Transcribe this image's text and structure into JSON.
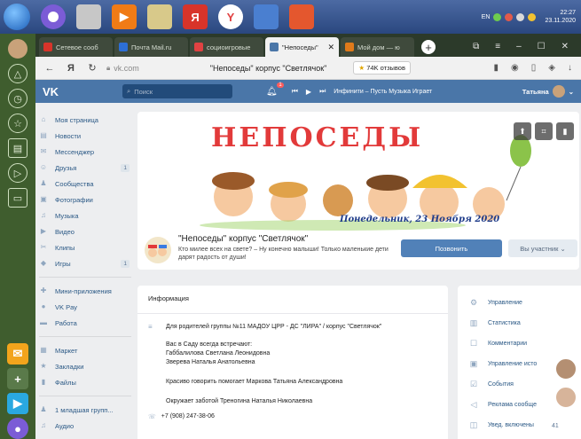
{
  "taskbar": {
    "apps": [
      {
        "icon": "start-orb"
      },
      {
        "icon": "app-circle-icon",
        "color": "#7b5cd6"
      },
      {
        "icon": "blank-window-icon",
        "color": "#c7c7c7"
      },
      {
        "icon": "media-player-icon",
        "color": "#f07b16"
      },
      {
        "icon": "notepad-icon",
        "color": "#d8c98a"
      },
      {
        "icon": "yandex-icon",
        "color": "#d8342a",
        "label": "Я"
      },
      {
        "icon": "yandex-browser-icon",
        "color": "#e14242",
        "label": "Y"
      },
      {
        "icon": "photo-viewer-icon",
        "color": "#4a7fd0"
      },
      {
        "icon": "presentation-icon",
        "color": "#e4572e"
      }
    ],
    "lang": "EN",
    "time": "22:27",
    "date": "23.11.2020"
  },
  "browser": {
    "tabs": [
      {
        "label": "Сетевое сооб",
        "fav_color": "#d8342a",
        "active": false
      },
      {
        "label": "Почта Mail.ru",
        "fav_color": "#2d6fd6",
        "active": false
      },
      {
        "label": "социоигровые",
        "fav_color": "#e14242",
        "active": false
      },
      {
        "label": "\"Непоседы\"",
        "fav_color": "#4a76a8",
        "active": true
      },
      {
        "label": "Мой дом — ю",
        "fav_color": "#e07a1a",
        "active": false
      }
    ],
    "url": "vk.com",
    "page_title": "\"Непоседы\" корпус \"Светлячок\"",
    "reviews": "74K отзывов"
  },
  "vk": {
    "logo": "VK",
    "search_placeholder": "Поиск",
    "player_text": "Инфинити – Пусть Музыка Играет",
    "user_name": "Татьяна",
    "menu": [
      {
        "icon": "home-icon",
        "glyph": "⌂",
        "label": "Моя страница",
        "count": ""
      },
      {
        "icon": "news-icon",
        "glyph": "▤",
        "label": "Новости",
        "count": ""
      },
      {
        "icon": "messenger-icon",
        "glyph": "✉",
        "label": "Мессенджер",
        "count": ""
      },
      {
        "icon": "friends-icon",
        "glyph": "☺",
        "label": "Друзья",
        "count": "1"
      },
      {
        "icon": "communities-icon",
        "glyph": "♟",
        "label": "Сообщества",
        "count": ""
      },
      {
        "icon": "photos-icon",
        "glyph": "▣",
        "label": "Фотографии",
        "count": ""
      },
      {
        "icon": "music-icon",
        "glyph": "♫",
        "label": "Музыка",
        "count": ""
      },
      {
        "icon": "video-icon",
        "glyph": "▶",
        "label": "Видео",
        "count": ""
      },
      {
        "icon": "clips-icon",
        "glyph": "✂",
        "label": "Клипы",
        "count": ""
      },
      {
        "icon": "games-icon",
        "glyph": "◆",
        "label": "Игры",
        "count": "1"
      }
    ],
    "menu2": [
      {
        "icon": "mini-apps-icon",
        "glyph": "✚",
        "label": "Мини-приложения"
      },
      {
        "icon": "vkpay-icon",
        "glyph": "●",
        "label": "VK Pay"
      },
      {
        "icon": "work-icon",
        "glyph": "▬",
        "label": "Работа"
      }
    ],
    "menu3": [
      {
        "icon": "market-icon",
        "glyph": "▦",
        "label": "Маркет"
      },
      {
        "icon": "bookmarks-icon",
        "glyph": "★",
        "label": "Закладки"
      },
      {
        "icon": "files-icon",
        "glyph": "▮",
        "label": "Файлы"
      }
    ],
    "menu4": [
      {
        "icon": "group-icon",
        "glyph": "♟",
        "label": "1 младшая групп..."
      },
      {
        "icon": "audio-icon",
        "glyph": "♫",
        "label": "Аудио"
      }
    ]
  },
  "group": {
    "cover_title": "НЕПОСЕДЫ",
    "cover_date": "Понедельник, 23 Ноября 2020",
    "name": "\"Непоседы\" корпус \"Светлячок\"",
    "status": "Кто милее всех на свете? – Ну конечно малыши! Только маленькие дети дарят радость от души!",
    "call_button": "Позвонить",
    "member_button": "Вы участник",
    "member_chevron": "⌄"
  },
  "info": {
    "header": "Информация",
    "desc": "Для родителей группы №11 МАДОУ ЦРР - ДС \"ЛИРА\" / корпус \"Светлячок\"",
    "lines": [
      "Вас в Саду всегда встречают:",
      "Габбалилова Светлана Леонидовна",
      "Зверева Наталья Анатольевна",
      "",
      "Красиво говорить помогает Маркова Татьяна Александровна",
      "",
      "Окружает заботой Треногина Наталья Николаевна"
    ],
    "phone": "+7 (908) 247-38-06"
  },
  "management": [
    {
      "icon": "settings-icon",
      "glyph": "⚙",
      "label": "Управление"
    },
    {
      "icon": "stats-icon",
      "glyph": "▥",
      "label": "Статистика"
    },
    {
      "icon": "comments-icon",
      "glyph": "☐",
      "label": "Комментарии"
    },
    {
      "icon": "history-icon",
      "glyph": "▣",
      "label": "Управление исто"
    },
    {
      "icon": "events-icon",
      "glyph": "☑",
      "label": "События"
    },
    {
      "icon": "ads-icon",
      "glyph": "◁",
      "label": "Реклама сообще"
    },
    {
      "icon": "notifications-icon",
      "glyph": "◫",
      "label": "Увед. включены"
    }
  ],
  "chat_count": "41"
}
